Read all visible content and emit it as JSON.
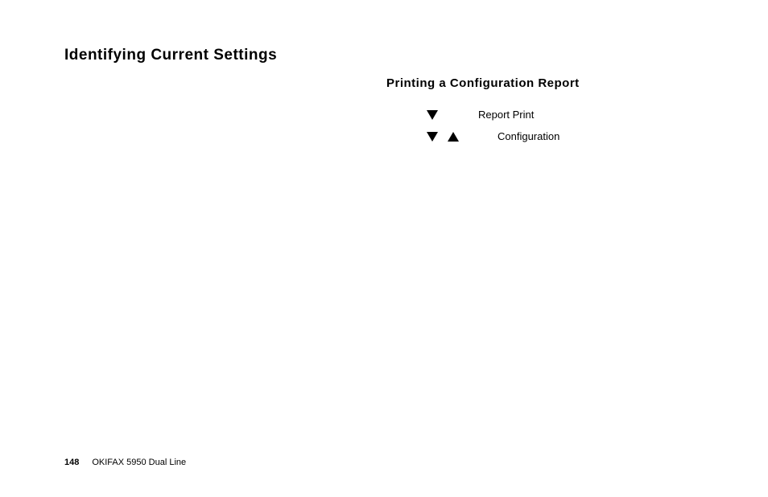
{
  "title": "Identifying Current Settings",
  "section": {
    "title": "Printing a Configuration Report",
    "steps": [
      {
        "label": "Report Print"
      },
      {
        "label": "Configuration"
      }
    ]
  },
  "footer": {
    "page_number": "148",
    "product": "OKIFAX 5950 Dual Line"
  }
}
